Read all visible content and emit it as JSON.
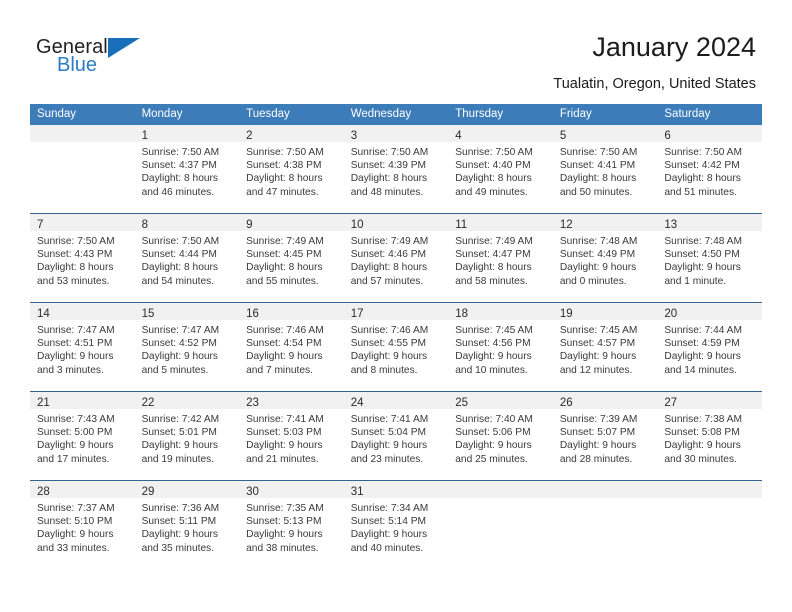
{
  "brand": {
    "name_top": "General",
    "name_bottom": "Blue",
    "accent_color": "#2b7cc4",
    "triangle_color": "#1a6fbb"
  },
  "header": {
    "title": "January 2024",
    "location": "Tualatin, Oregon, United States",
    "header_bg_color": "#3c7cb9",
    "row_divider_color": "#35628f",
    "daynum_band_color": "#f1f1f1"
  },
  "weekdays": [
    "Sunday",
    "Monday",
    "Tuesday",
    "Wednesday",
    "Thursday",
    "Friday",
    "Saturday"
  ],
  "weeks": [
    [
      {
        "day": "",
        "sunrise": "",
        "sunset": "",
        "daylight_line1": "",
        "daylight_line2": ""
      },
      {
        "day": "1",
        "sunrise": "Sunrise: 7:50 AM",
        "sunset": "Sunset: 4:37 PM",
        "daylight_line1": "Daylight: 8 hours",
        "daylight_line2": "and 46 minutes."
      },
      {
        "day": "2",
        "sunrise": "Sunrise: 7:50 AM",
        "sunset": "Sunset: 4:38 PM",
        "daylight_line1": "Daylight: 8 hours",
        "daylight_line2": "and 47 minutes."
      },
      {
        "day": "3",
        "sunrise": "Sunrise: 7:50 AM",
        "sunset": "Sunset: 4:39 PM",
        "daylight_line1": "Daylight: 8 hours",
        "daylight_line2": "and 48 minutes."
      },
      {
        "day": "4",
        "sunrise": "Sunrise: 7:50 AM",
        "sunset": "Sunset: 4:40 PM",
        "daylight_line1": "Daylight: 8 hours",
        "daylight_line2": "and 49 minutes."
      },
      {
        "day": "5",
        "sunrise": "Sunrise: 7:50 AM",
        "sunset": "Sunset: 4:41 PM",
        "daylight_line1": "Daylight: 8 hours",
        "daylight_line2": "and 50 minutes."
      },
      {
        "day": "6",
        "sunrise": "Sunrise: 7:50 AM",
        "sunset": "Sunset: 4:42 PM",
        "daylight_line1": "Daylight: 8 hours",
        "daylight_line2": "and 51 minutes."
      }
    ],
    [
      {
        "day": "7",
        "sunrise": "Sunrise: 7:50 AM",
        "sunset": "Sunset: 4:43 PM",
        "daylight_line1": "Daylight: 8 hours",
        "daylight_line2": "and 53 minutes."
      },
      {
        "day": "8",
        "sunrise": "Sunrise: 7:50 AM",
        "sunset": "Sunset: 4:44 PM",
        "daylight_line1": "Daylight: 8 hours",
        "daylight_line2": "and 54 minutes."
      },
      {
        "day": "9",
        "sunrise": "Sunrise: 7:49 AM",
        "sunset": "Sunset: 4:45 PM",
        "daylight_line1": "Daylight: 8 hours",
        "daylight_line2": "and 55 minutes."
      },
      {
        "day": "10",
        "sunrise": "Sunrise: 7:49 AM",
        "sunset": "Sunset: 4:46 PM",
        "daylight_line1": "Daylight: 8 hours",
        "daylight_line2": "and 57 minutes."
      },
      {
        "day": "11",
        "sunrise": "Sunrise: 7:49 AM",
        "sunset": "Sunset: 4:47 PM",
        "daylight_line1": "Daylight: 8 hours",
        "daylight_line2": "and 58 minutes."
      },
      {
        "day": "12",
        "sunrise": "Sunrise: 7:48 AM",
        "sunset": "Sunset: 4:49 PM",
        "daylight_line1": "Daylight: 9 hours",
        "daylight_line2": "and 0 minutes."
      },
      {
        "day": "13",
        "sunrise": "Sunrise: 7:48 AM",
        "sunset": "Sunset: 4:50 PM",
        "daylight_line1": "Daylight: 9 hours",
        "daylight_line2": "and 1 minute."
      }
    ],
    [
      {
        "day": "14",
        "sunrise": "Sunrise: 7:47 AM",
        "sunset": "Sunset: 4:51 PM",
        "daylight_line1": "Daylight: 9 hours",
        "daylight_line2": "and 3 minutes."
      },
      {
        "day": "15",
        "sunrise": "Sunrise: 7:47 AM",
        "sunset": "Sunset: 4:52 PM",
        "daylight_line1": "Daylight: 9 hours",
        "daylight_line2": "and 5 minutes."
      },
      {
        "day": "16",
        "sunrise": "Sunrise: 7:46 AM",
        "sunset": "Sunset: 4:54 PM",
        "daylight_line1": "Daylight: 9 hours",
        "daylight_line2": "and 7 minutes."
      },
      {
        "day": "17",
        "sunrise": "Sunrise: 7:46 AM",
        "sunset": "Sunset: 4:55 PM",
        "daylight_line1": "Daylight: 9 hours",
        "daylight_line2": "and 8 minutes."
      },
      {
        "day": "18",
        "sunrise": "Sunrise: 7:45 AM",
        "sunset": "Sunset: 4:56 PM",
        "daylight_line1": "Daylight: 9 hours",
        "daylight_line2": "and 10 minutes."
      },
      {
        "day": "19",
        "sunrise": "Sunrise: 7:45 AM",
        "sunset": "Sunset: 4:57 PM",
        "daylight_line1": "Daylight: 9 hours",
        "daylight_line2": "and 12 minutes."
      },
      {
        "day": "20",
        "sunrise": "Sunrise: 7:44 AM",
        "sunset": "Sunset: 4:59 PM",
        "daylight_line1": "Daylight: 9 hours",
        "daylight_line2": "and 14 minutes."
      }
    ],
    [
      {
        "day": "21",
        "sunrise": "Sunrise: 7:43 AM",
        "sunset": "Sunset: 5:00 PM",
        "daylight_line1": "Daylight: 9 hours",
        "daylight_line2": "and 17 minutes."
      },
      {
        "day": "22",
        "sunrise": "Sunrise: 7:42 AM",
        "sunset": "Sunset: 5:01 PM",
        "daylight_line1": "Daylight: 9 hours",
        "daylight_line2": "and 19 minutes."
      },
      {
        "day": "23",
        "sunrise": "Sunrise: 7:41 AM",
        "sunset": "Sunset: 5:03 PM",
        "daylight_line1": "Daylight: 9 hours",
        "daylight_line2": "and 21 minutes."
      },
      {
        "day": "24",
        "sunrise": "Sunrise: 7:41 AM",
        "sunset": "Sunset: 5:04 PM",
        "daylight_line1": "Daylight: 9 hours",
        "daylight_line2": "and 23 minutes."
      },
      {
        "day": "25",
        "sunrise": "Sunrise: 7:40 AM",
        "sunset": "Sunset: 5:06 PM",
        "daylight_line1": "Daylight: 9 hours",
        "daylight_line2": "and 25 minutes."
      },
      {
        "day": "26",
        "sunrise": "Sunrise: 7:39 AM",
        "sunset": "Sunset: 5:07 PM",
        "daylight_line1": "Daylight: 9 hours",
        "daylight_line2": "and 28 minutes."
      },
      {
        "day": "27",
        "sunrise": "Sunrise: 7:38 AM",
        "sunset": "Sunset: 5:08 PM",
        "daylight_line1": "Daylight: 9 hours",
        "daylight_line2": "and 30 minutes."
      }
    ],
    [
      {
        "day": "28",
        "sunrise": "Sunrise: 7:37 AM",
        "sunset": "Sunset: 5:10 PM",
        "daylight_line1": "Daylight: 9 hours",
        "daylight_line2": "and 33 minutes."
      },
      {
        "day": "29",
        "sunrise": "Sunrise: 7:36 AM",
        "sunset": "Sunset: 5:11 PM",
        "daylight_line1": "Daylight: 9 hours",
        "daylight_line2": "and 35 minutes."
      },
      {
        "day": "30",
        "sunrise": "Sunrise: 7:35 AM",
        "sunset": "Sunset: 5:13 PM",
        "daylight_line1": "Daylight: 9 hours",
        "daylight_line2": "and 38 minutes."
      },
      {
        "day": "31",
        "sunrise": "Sunrise: 7:34 AM",
        "sunset": "Sunset: 5:14 PM",
        "daylight_line1": "Daylight: 9 hours",
        "daylight_line2": "and 40 minutes."
      },
      {
        "day": "",
        "sunrise": "",
        "sunset": "",
        "daylight_line1": "",
        "daylight_line2": ""
      },
      {
        "day": "",
        "sunrise": "",
        "sunset": "",
        "daylight_line1": "",
        "daylight_line2": ""
      },
      {
        "day": "",
        "sunrise": "",
        "sunset": "",
        "daylight_line1": "",
        "daylight_line2": ""
      }
    ]
  ]
}
